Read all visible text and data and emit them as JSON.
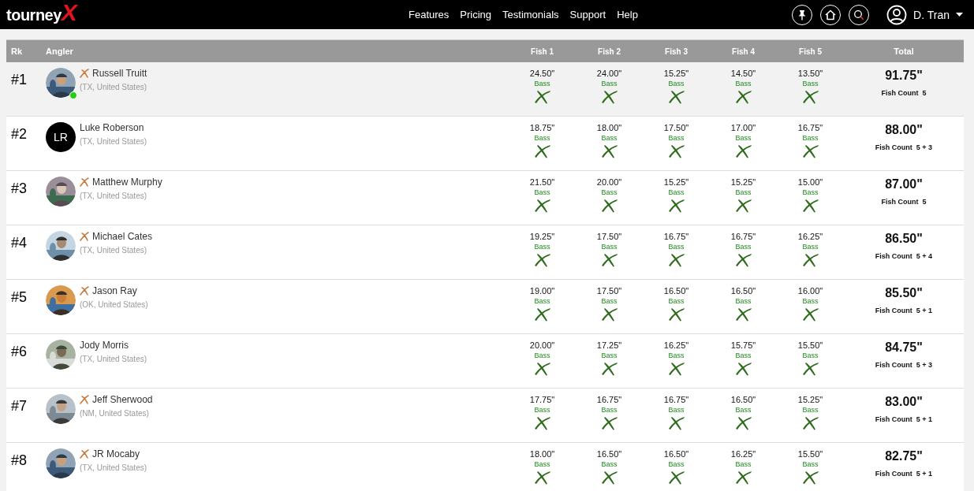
{
  "header": {
    "logo": {
      "text": "tourney",
      "mark": "X"
    },
    "nav": [
      "Features",
      "Pricing",
      "Testimonials",
      "Support",
      "Help"
    ],
    "user": {
      "name": "D. Tran"
    }
  },
  "table": {
    "columns": {
      "rank": "Rk",
      "angler": "Angler",
      "fish": [
        "Fish 1",
        "Fish 2",
        "Fish 3",
        "Fish 4",
        "Fish 5"
      ],
      "total": "Total"
    },
    "rows": [
      {
        "rank": "#1",
        "selected": true,
        "online": true,
        "badge": true,
        "name": "Russell Truitt",
        "location": "(TX, United States)",
        "fish": [
          {
            "length": "24.50\"",
            "species": "Bass"
          },
          {
            "length": "24.00\"",
            "species": "Bass"
          },
          {
            "length": "15.25\"",
            "species": "Bass"
          },
          {
            "length": "14.50\"",
            "species": "Bass"
          },
          {
            "length": "13.50\"",
            "species": "Bass"
          }
        ],
        "total": "91.75\"",
        "count_label": "Fish Count",
        "count": "5"
      },
      {
        "rank": "#2",
        "selected": false,
        "avatar": {
          "kind": "initials",
          "text": "LR"
        },
        "online": false,
        "badge": false,
        "name": "Luke Roberson",
        "location": "(TX, United States)",
        "fish": [
          {
            "length": "18.75\"",
            "species": "Bass"
          },
          {
            "length": "18.00\"",
            "species": "Bass"
          },
          {
            "length": "17.50\"",
            "species": "Bass"
          },
          {
            "length": "17.00\"",
            "species": "Bass"
          },
          {
            "length": "16.75\"",
            "species": "Bass"
          }
        ],
        "total": "88.00\"",
        "count_label": "Fish Count",
        "count": "5 + 3"
      },
      {
        "rank": "#3",
        "selected": false,
        "online": false,
        "badge": true,
        "name": "Matthew Murphy",
        "location": "(TX, United States)",
        "fish": [
          {
            "length": "21.50\"",
            "species": "Bass"
          },
          {
            "length": "20.00\"",
            "species": "Bass"
          },
          {
            "length": "15.25\"",
            "species": "Bass"
          },
          {
            "length": "15.25\"",
            "species": "Bass"
          },
          {
            "length": "15.00\"",
            "species": "Bass"
          }
        ],
        "total": "87.00\"",
        "count_label": "Fish Count",
        "count": "5"
      },
      {
        "rank": "#4",
        "selected": false,
        "online": false,
        "badge": true,
        "name": "Michael Cates",
        "location": "(TX, United States)",
        "fish": [
          {
            "length": "19.25\"",
            "species": "Bass"
          },
          {
            "length": "17.50\"",
            "species": "Bass"
          },
          {
            "length": "16.75\"",
            "species": "Bass"
          },
          {
            "length": "16.75\"",
            "species": "Bass"
          },
          {
            "length": "16.25\"",
            "species": "Bass"
          }
        ],
        "total": "86.50\"",
        "count_label": "Fish Count",
        "count": "5 + 4"
      },
      {
        "rank": "#5",
        "selected": false,
        "online": false,
        "badge": true,
        "name": "Jason Ray",
        "location": "(OK, United States)",
        "fish": [
          {
            "length": "19.00\"",
            "species": "Bass"
          },
          {
            "length": "17.50\"",
            "species": "Bass"
          },
          {
            "length": "16.50\"",
            "species": "Bass"
          },
          {
            "length": "16.50\"",
            "species": "Bass"
          },
          {
            "length": "16.00\"",
            "species": "Bass"
          }
        ],
        "total": "85.50\"",
        "count_label": "Fish Count",
        "count": "5 + 1"
      },
      {
        "rank": "#6",
        "selected": false,
        "online": false,
        "badge": false,
        "name": "Jody Morris",
        "location": "(TX, United States)",
        "fish": [
          {
            "length": "20.00\"",
            "species": "Bass"
          },
          {
            "length": "17.25\"",
            "species": "Bass"
          },
          {
            "length": "16.25\"",
            "species": "Bass"
          },
          {
            "length": "15.75\"",
            "species": "Bass"
          },
          {
            "length": "15.50\"",
            "species": "Bass"
          }
        ],
        "total": "84.75\"",
        "count_label": "Fish Count",
        "count": "5 + 3"
      },
      {
        "rank": "#7",
        "selected": false,
        "online": false,
        "badge": true,
        "name": "Jeff Sherwood",
        "location": "(NM, United States)",
        "fish": [
          {
            "length": "17.75\"",
            "species": "Bass"
          },
          {
            "length": "16.75\"",
            "species": "Bass"
          },
          {
            "length": "16.75\"",
            "species": "Bass"
          },
          {
            "length": "16.50\"",
            "species": "Bass"
          },
          {
            "length": "15.25\"",
            "species": "Bass"
          }
        ],
        "total": "83.00\"",
        "count_label": "Fish Count",
        "count": "5 + 1"
      },
      {
        "rank": "#8",
        "selected": false,
        "online": false,
        "badge": true,
        "name": "JR Mocaby",
        "location": "(TX, United States)",
        "fish": [
          {
            "length": "18.00\"",
            "species": "Bass"
          },
          {
            "length": "16.50\"",
            "species": "Bass"
          },
          {
            "length": "16.50\"",
            "species": "Bass"
          },
          {
            "length": "16.25\"",
            "species": "Bass"
          },
          {
            "length": "15.50\"",
            "species": "Bass"
          }
        ],
        "total": "82.75\"",
        "count_label": "Fish Count",
        "count": "5 + 1"
      }
    ]
  }
}
